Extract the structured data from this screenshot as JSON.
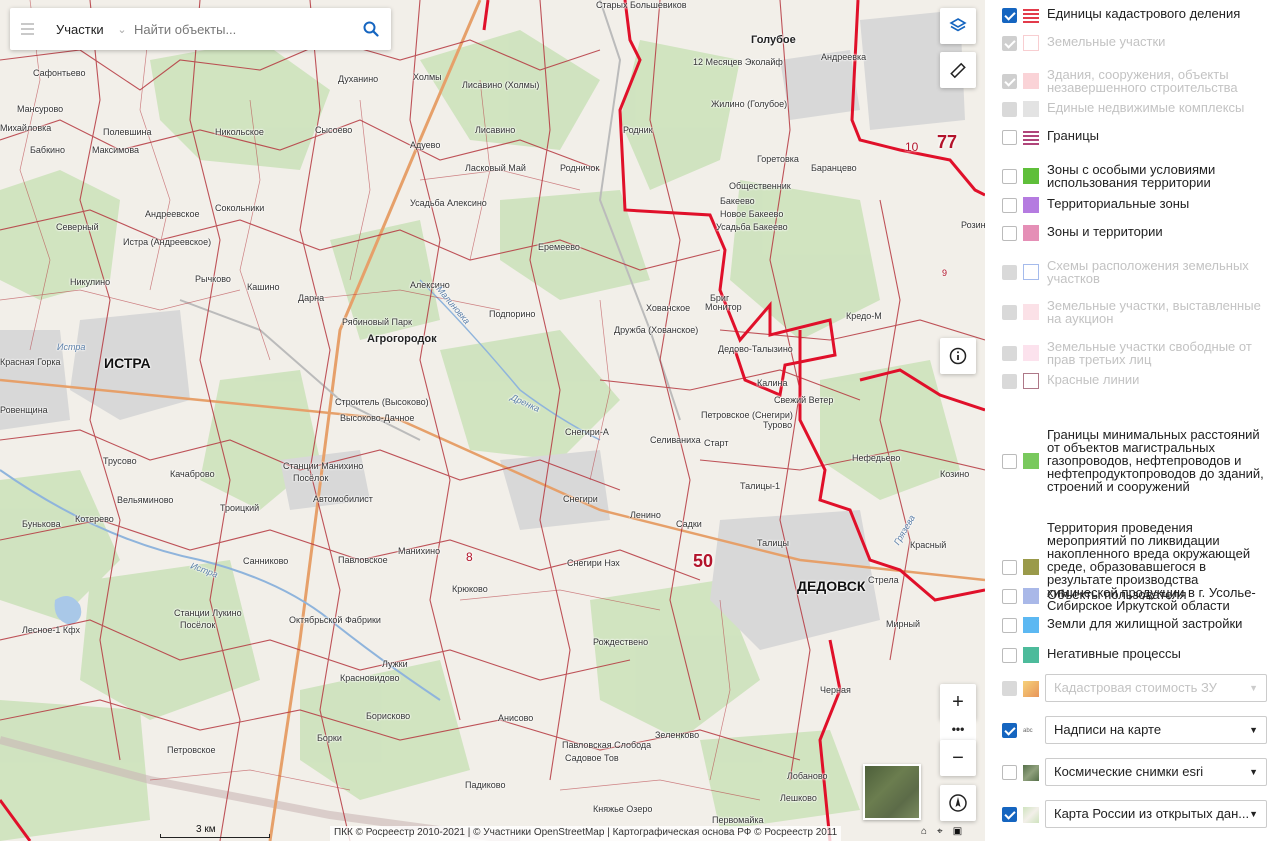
{
  "search": {
    "category": "Участки",
    "placeholder": "Найти объекты..."
  },
  "map": {
    "labels": {
      "cities": [
        "ИСТРА",
        "ДЕДОВСК",
        "Агрогородок",
        "Голубое"
      ],
      "region_codes": [
        "77",
        "50",
        "10",
        "8",
        "9"
      ],
      "settlements": [
        "Старых Большевиков",
        "Голубое",
        "12 Месяцев Эколайф",
        "Андреевка",
        "Жилино (Голубое)",
        "Духанино",
        "Холмы",
        "Лисавино (Холмы)",
        "Лисавино",
        "Сафонтьево",
        "Мансурово",
        "Михайловка",
        "Полевшина",
        "Бабкино",
        "Максимова",
        "Никольское",
        "Сысоево",
        "Адуево",
        "Родник",
        "Горетовка",
        "Баранцево",
        "Ласковый Май",
        "Родничок",
        "Общественник",
        "Бакеево",
        "Новое Бакеево",
        "Усадьба Бакеево",
        "Северный",
        "Андреевское",
        "Сокольники",
        "Усадьба Алексино",
        "Истра (Андреевское)",
        "Еремеево",
        "Никулино",
        "Рычково",
        "Кашино",
        "Дарна",
        "Алексино",
        "Подпорино",
        "Хованское",
        "Бриг",
        "Монитор",
        "Кредо-М",
        "Красная Горка",
        "Рябиновый Парк",
        "Дружба (Хованское)",
        "Дедово-Талызино",
        "Калина",
        "Свежий Ветер",
        "Строитель (Высоково)",
        "Высоково-Дачное",
        "Петровское (Снегири)",
        "Турово",
        "Снегири-А",
        "Селиваниха",
        "Старт",
        "Нефедьево",
        "Трусово",
        "Станции Манихино",
        "Посёлок",
        "Качаброво",
        "Талицы-1",
        "Козино",
        "Вельяминово",
        "Автомобилист",
        "Снегири",
        "Ленино",
        "Садки",
        "Талицы",
        "Троицкий",
        "Бунькова",
        "Котерево",
        "Манихино",
        "Павловское",
        "Снегири Нэх",
        "Санниково",
        "Стрела",
        "Крюково",
        "Станции Лукино",
        "Октябрьской Фабрики",
        "Посёлок",
        "Лесное-1 Кфх",
        "Мирный",
        "Рождествено",
        "Лужки",
        "Красновидово",
        "Борисково",
        "Черная",
        "Анисово",
        "Зеленково",
        "Борки",
        "Петровское",
        "Павловская Слобода",
        "Садовое Тов",
        "Лобаново",
        "Падиково",
        "Лешково",
        "Княжье Озеро",
        "Первомайка",
        "Розинка",
        "Красный",
        "Ровенщина"
      ],
      "rivers": [
        "Истра",
        "Грязева",
        "Дренка",
        "Малиновка",
        "Истра"
      ]
    },
    "scale": "3 км",
    "attribution": "ПКК © Росреестр 2010-2021 | © Участники OpenStreetMap | Картографическая основа РФ © Росреестр 2011",
    "controls": {
      "layers": "layers-icon",
      "ruler": "ruler-icon",
      "info": "info-icon",
      "zoom_in": "+",
      "more": "•••",
      "zoom_out": "−",
      "locate": "locate-icon"
    }
  },
  "layers": [
    {
      "label": "Единицы кадастрового деления",
      "checked": true,
      "enabled": true,
      "swatch": "#e33b4b"
    },
    {
      "label": "Земельные участки",
      "checked": true,
      "enabled": false,
      "swatch": "#f5aeb4"
    },
    {
      "label": "Здания, сооружения, объекты незавершенного строительства",
      "checked": true,
      "enabled": false,
      "swatch": "#f07a86"
    },
    {
      "label": "Единые недвижимые комплексы",
      "checked": false,
      "enabled": false,
      "swatch": "#aaaaaa"
    },
    {
      "label": "Границы",
      "checked": false,
      "enabled": true,
      "swatch": "#b0457a"
    },
    {
      "label": "Зоны с особыми условиями использования территории",
      "checked": false,
      "enabled": true,
      "swatch": "#5fbf3a"
    },
    {
      "label": "Территориальные зоны",
      "checked": false,
      "enabled": true,
      "swatch": "#b57be0"
    },
    {
      "label": "Зоны и территории",
      "checked": false,
      "enabled": true,
      "swatch": "#e58fb6"
    },
    {
      "label": "Схемы расположения земельных участков",
      "checked": false,
      "enabled": false,
      "swatch": "#6b8fe0"
    },
    {
      "label": "Земельные участки, выставленные на аукцион",
      "checked": false,
      "enabled": false,
      "swatch": "#f2a6b8"
    },
    {
      "label": "Земельные участки свободные от прав третьих лиц",
      "checked": false,
      "enabled": false,
      "swatch": "#f7a8c8"
    },
    {
      "label": "Красные линии",
      "checked": false,
      "enabled": false,
      "swatch": "#7a1f3a"
    },
    {
      "label": "Границы минимальных расстояний от объектов магистральных газопроводов, нефтепроводов и нефтепродуктопроводов до зданий, строений и сооружений",
      "checked": false,
      "enabled": true,
      "swatch": "#79c95d"
    },
    {
      "label": "Территория проведения мероприятий по ликвидации накопленного вреда окружающей среде, образовавшегося в результате производства химической продукции в г. Усолье-Сибирское Иркутской области",
      "checked": false,
      "enabled": true,
      "swatch": "#9a9a4a"
    },
    {
      "label": "Объекты пользователя",
      "checked": false,
      "enabled": true,
      "swatch": "#a9b8e8"
    },
    {
      "label": "Земли для жилищной застройки",
      "checked": false,
      "enabled": true,
      "swatch": "#5cb8f2"
    },
    {
      "label": "Негативные процессы",
      "checked": false,
      "enabled": true,
      "swatch": "#4dbb9b"
    }
  ],
  "basemaps": [
    {
      "label": "Кадастровая стоимость ЗУ",
      "checked": false,
      "enabled": false
    },
    {
      "label": "Надписи на карте",
      "checked": true,
      "enabled": true
    },
    {
      "label": "Космические снимки esri",
      "checked": false,
      "enabled": true
    },
    {
      "label": "Карта России из открытых дан...",
      "checked": true,
      "enabled": true
    }
  ],
  "colors": {
    "boundary": "#b5373f",
    "major_boundary": "#e0102a",
    "forest": "#cfe3be",
    "urban": "#d6d6d6",
    "accent": "#1565c0"
  }
}
